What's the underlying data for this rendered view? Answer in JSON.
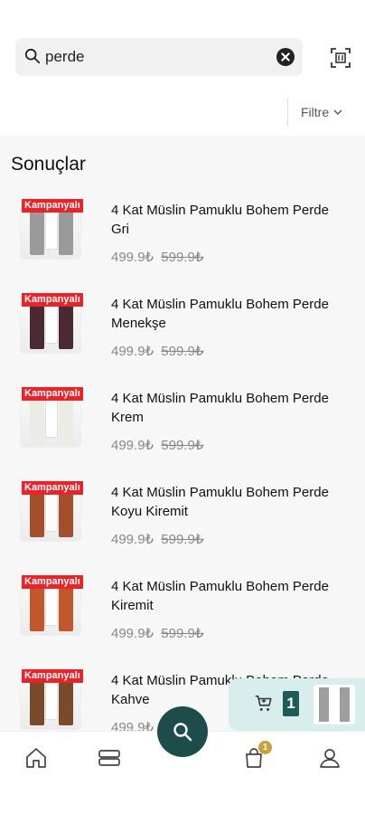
{
  "search": {
    "query": "perde",
    "placeholder": ""
  },
  "filter": {
    "label": "Filtre"
  },
  "results": {
    "heading": "Sonuçlar",
    "items": [
      {
        "badge": "Kampanyalı",
        "title": "4 Kat Müslin Pamuklu Bohem Perde Gri",
        "price": "499.9₺",
        "old_price": "599.9₺",
        "curtain_color": "#9a9a9a"
      },
      {
        "badge": "Kampanyalı",
        "title": "4 Kat Müslin Pamuklu Bohem Perde Menekşe",
        "price": "499.9₺",
        "old_price": "599.9₺",
        "curtain_color": "#4a2a30"
      },
      {
        "badge": "Kampanyalı",
        "title": "4 Kat Müslin Pamuklu Bohem Perde Krem",
        "price": "499.9₺",
        "old_price": "599.9₺",
        "curtain_color": "#ecebe5"
      },
      {
        "badge": "Kampanyalı",
        "title": "4 Kat Müslin Pamuklu Bohem Perde Koyu Kiremit",
        "price": "499.9₺",
        "old_price": "599.9₺",
        "curtain_color": "#a44f2a"
      },
      {
        "badge": "Kampanyalı",
        "title": "4 Kat Müslin Pamuklu Bohem Perde Kiremit",
        "price": "499.9₺",
        "old_price": "599.9₺",
        "curtain_color": "#c2572e"
      },
      {
        "badge": "Kampanyalı",
        "title": "4 Kat Müslin Pamuklu Bohem Perde Kahve",
        "price": "499.9₺",
        "old_price": "599.9₺",
        "curtain_color": "#7a4a2a"
      }
    ]
  },
  "cart_float": {
    "count": "1"
  },
  "bottom_nav": {
    "items": [
      "home-icon",
      "categories-icon",
      "search-icon",
      "cart-icon",
      "user-icon"
    ],
    "cart_badge": "1"
  },
  "colors": {
    "accent": "#1d4d4a",
    "badge": "#e8232a",
    "cart_badge": "#c9a13b",
    "cart_float_bg": "#d8eeec"
  }
}
